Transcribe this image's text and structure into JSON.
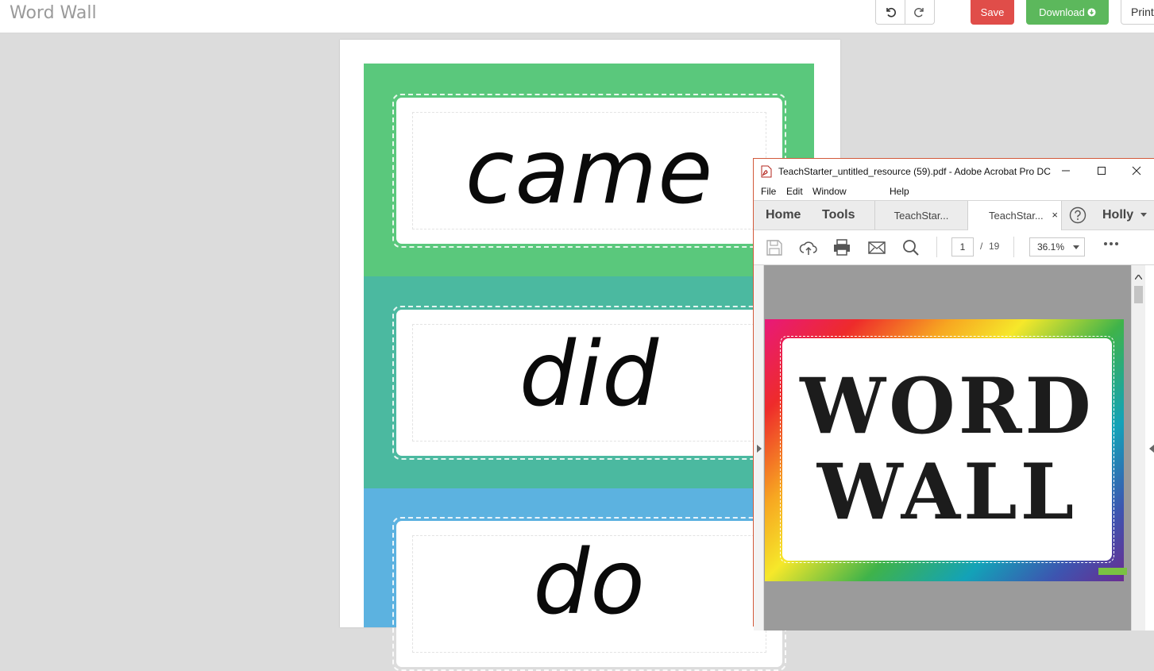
{
  "app": {
    "title": "Word Wall"
  },
  "toolbar": {
    "undo_icon": "undo-icon",
    "redo_icon": "redo-icon",
    "save_label": "Save",
    "download_label": "Download",
    "download_icon": "arrow-down-circle-icon",
    "print_label": "Print"
  },
  "colors": {
    "save": "#e04d49",
    "download": "#5cb85c",
    "band_green": "#5ac87c",
    "band_teal": "#4bb9a0",
    "band_blue": "#5cb2e0",
    "acrobat_border": "#d25a3b"
  },
  "document": {
    "cards": [
      {
        "word": "came",
        "color": "#5ac87c"
      },
      {
        "word": "did",
        "color": "#4bb9a0"
      },
      {
        "word": "do",
        "color": "#5cb2e0"
      }
    ]
  },
  "acrobat": {
    "title": "TeachStarter_untitled_resource (59).pdf - Adobe Acrobat Pro DC",
    "menu": [
      "File",
      "Edit",
      "Window",
      "Help"
    ],
    "tabs": {
      "home": "Home",
      "tools": "Tools",
      "doc1": "TeachStar...",
      "doc2": "TeachStar...",
      "close": "×"
    },
    "user": "Holly",
    "page_current": "1",
    "page_separator": "/",
    "page_total": "19",
    "zoom": "36.1%",
    "cover_lines": [
      "WORD",
      "WALL"
    ]
  }
}
